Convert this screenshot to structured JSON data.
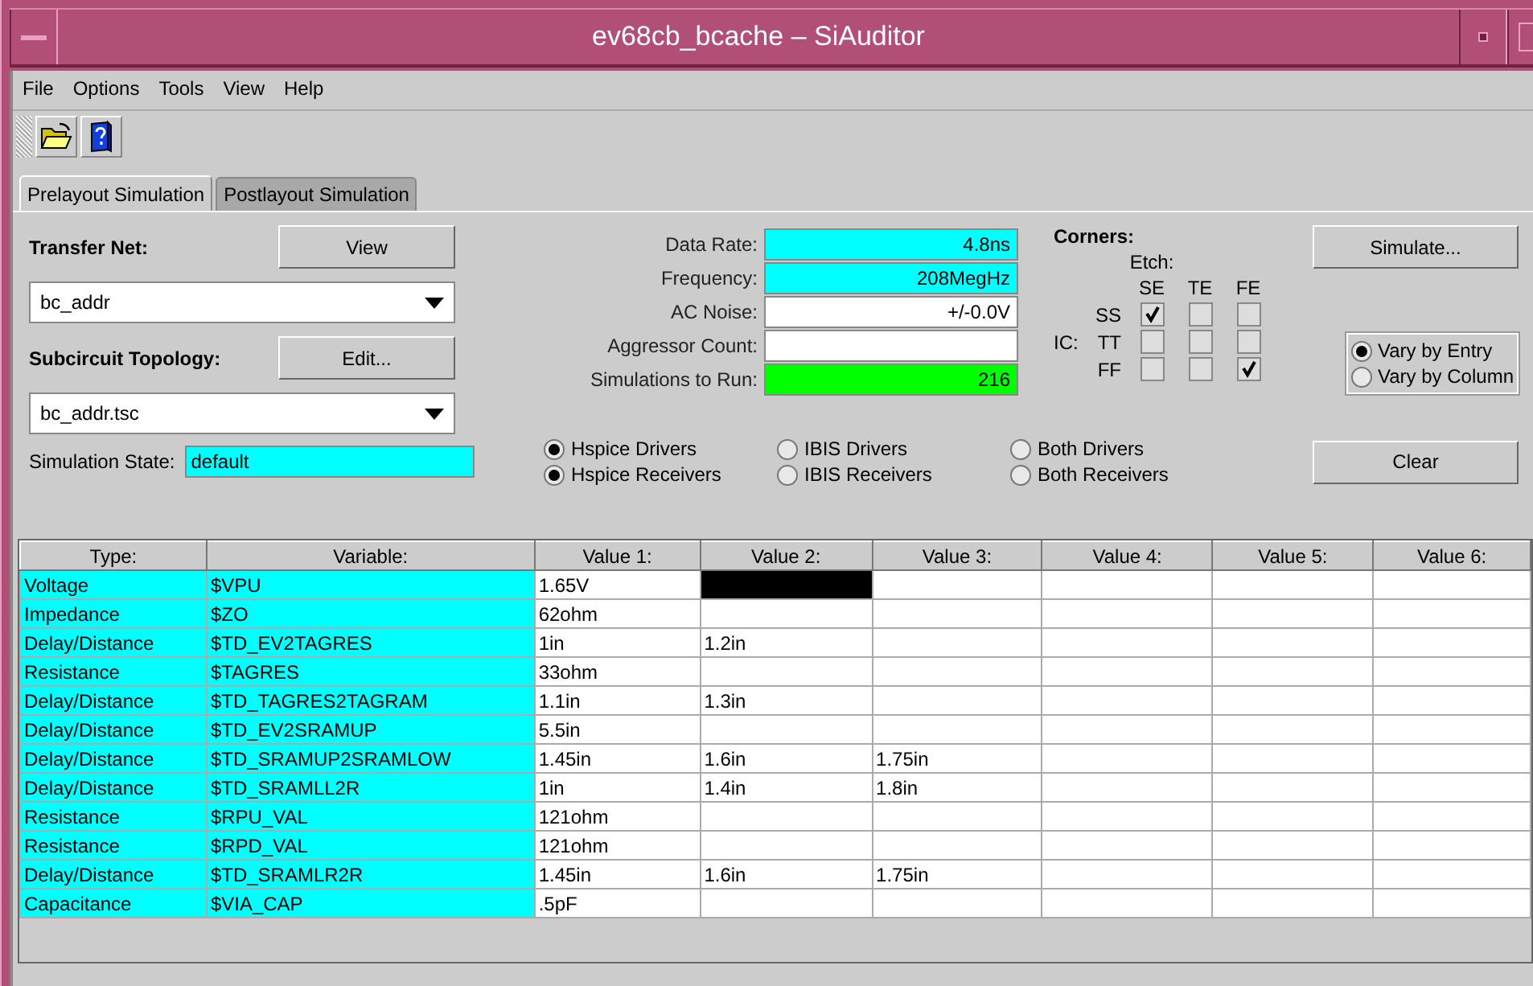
{
  "window": {
    "title": "ev68cb_bcache – SiAuditor"
  },
  "menu": [
    "File",
    "Options",
    "Tools",
    "View",
    "Help"
  ],
  "tabs": [
    {
      "label": "Prelayout Simulation",
      "selected": true
    },
    {
      "label": "Postlayout Simulation",
      "selected": false
    }
  ],
  "transfer_net": {
    "label": "Transfer Net:",
    "button": "View",
    "value": "bc_addr"
  },
  "subcircuit": {
    "label": "Subcircuit Topology:",
    "button": "Edit...",
    "value": "bc_addr.tsc"
  },
  "simulation_state": {
    "label": "Simulation State:",
    "value": "default"
  },
  "fields": [
    {
      "label": "Data Rate:",
      "value": "4.8ns",
      "color": "#00ffff"
    },
    {
      "label": "Frequency:",
      "value": "208MegHz",
      "color": "#00ffff"
    },
    {
      "label": "AC Noise:",
      "value": "+/-0.0V",
      "color": "#ffffff"
    },
    {
      "label": "Aggressor Count:",
      "color": "#ffffff"
    },
    {
      "label": "Simulations to Run:",
      "value": "216",
      "color": "#00ff00"
    }
  ],
  "corners": {
    "title": "Corners:",
    "etch_label": "Etch:",
    "ic_label": "IC:",
    "columns": [
      "SE",
      "TE",
      "FE"
    ],
    "rows": [
      {
        "label": "SS",
        "checks": [
          true,
          false,
          false
        ]
      },
      {
        "label": "TT",
        "checks": [
          false,
          false,
          false
        ]
      },
      {
        "label": "FF",
        "checks": [
          false,
          false,
          true
        ]
      }
    ]
  },
  "simulate_button": "Simulate...",
  "vary": [
    {
      "label": "Vary by Entry",
      "selected": true
    },
    {
      "label": "Vary by Column",
      "selected": false
    }
  ],
  "model_options": [
    [
      {
        "label": "Hspice Drivers",
        "selected": true
      },
      {
        "label": "IBIS Drivers",
        "selected": false
      },
      {
        "label": "Both Drivers",
        "selected": false
      }
    ],
    [
      {
        "label": "Hspice Receivers",
        "selected": true
      },
      {
        "label": "IBIS Receivers",
        "selected": false
      },
      {
        "label": "Both Receivers",
        "selected": false
      }
    ]
  ],
  "clear_button": "Clear",
  "table": {
    "columns": [
      "Type:",
      "Variable:",
      "Value 1:",
      "Value 2:",
      "Value 3:",
      "Value 4:",
      "Value 5:",
      "Value 6:"
    ],
    "rows": [
      {
        "cells": [
          {
            "text": "Voltage",
            "selected": false
          },
          {
            "text": "$VPU",
            "selected": false
          },
          {
            "text": "1.65V",
            "selected": false
          },
          {
            "text": "",
            "selected": true
          },
          {
            "text": "",
            "selected": false
          },
          {
            "text": "",
            "selected": false
          },
          {
            "text": "",
            "selected": false
          },
          {
            "text": "",
            "selected": false
          }
        ]
      },
      {
        "cells": [
          {
            "text": "Impedance",
            "selected": false
          },
          {
            "text": "$ZO",
            "selected": false
          },
          {
            "text": "62ohm",
            "selected": false
          },
          {
            "text": "",
            "selected": false
          },
          {
            "text": "",
            "selected": false
          },
          {
            "text": "",
            "selected": false
          },
          {
            "text": "",
            "selected": false
          },
          {
            "text": "",
            "selected": false
          }
        ]
      },
      {
        "cells": [
          {
            "text": "Delay/Distance",
            "selected": false
          },
          {
            "text": "$TD_EV2TAGRES",
            "selected": false
          },
          {
            "text": "1in",
            "selected": false
          },
          {
            "text": "1.2in",
            "selected": false
          },
          {
            "text": "",
            "selected": false
          },
          {
            "text": "",
            "selected": false
          },
          {
            "text": "",
            "selected": false
          },
          {
            "text": "",
            "selected": false
          }
        ]
      },
      {
        "cells": [
          {
            "text": "Resistance",
            "selected": false
          },
          {
            "text": "$TAGRES",
            "selected": false
          },
          {
            "text": "33ohm",
            "selected": false
          },
          {
            "text": "",
            "selected": false
          },
          {
            "text": "",
            "selected": false
          },
          {
            "text": "",
            "selected": false
          },
          {
            "text": "",
            "selected": false
          },
          {
            "text": "",
            "selected": false
          }
        ]
      },
      {
        "cells": [
          {
            "text": "Delay/Distance",
            "selected": false
          },
          {
            "text": "$TD_TAGRES2TAGRAM",
            "selected": false
          },
          {
            "text": "1.1in",
            "selected": false
          },
          {
            "text": "1.3in",
            "selected": false
          },
          {
            "text": "",
            "selected": false
          },
          {
            "text": "",
            "selected": false
          },
          {
            "text": "",
            "selected": false
          },
          {
            "text": "",
            "selected": false
          }
        ]
      },
      {
        "cells": [
          {
            "text": "Delay/Distance",
            "selected": false
          },
          {
            "text": "$TD_EV2SRAMUP",
            "selected": false
          },
          {
            "text": "5.5in",
            "selected": false
          },
          {
            "text": "",
            "selected": false
          },
          {
            "text": "",
            "selected": false
          },
          {
            "text": "",
            "selected": false
          },
          {
            "text": "",
            "selected": false
          },
          {
            "text": "",
            "selected": false
          }
        ]
      },
      {
        "cells": [
          {
            "text": "Delay/Distance",
            "selected": false
          },
          {
            "text": "$TD_SRAMUP2SRAMLOW",
            "selected": false
          },
          {
            "text": "1.45in",
            "selected": false
          },
          {
            "text": "1.6in",
            "selected": false
          },
          {
            "text": "1.75in",
            "selected": false
          },
          {
            "text": "",
            "selected": false
          },
          {
            "text": "",
            "selected": false
          },
          {
            "text": "",
            "selected": false
          }
        ]
      },
      {
        "cells": [
          {
            "text": "Delay/Distance",
            "selected": false
          },
          {
            "text": "$TD_SRAMLL2R",
            "selected": false
          },
          {
            "text": "1in",
            "selected": false
          },
          {
            "text": "1.4in",
            "selected": false
          },
          {
            "text": "1.8in",
            "selected": false
          },
          {
            "text": "",
            "selected": false
          },
          {
            "text": "",
            "selected": false
          },
          {
            "text": "",
            "selected": false
          }
        ]
      },
      {
        "cells": [
          {
            "text": "Resistance",
            "selected": false
          },
          {
            "text": "$RPU_VAL",
            "selected": false
          },
          {
            "text": "121ohm",
            "selected": false
          },
          {
            "text": "",
            "selected": false
          },
          {
            "text": "",
            "selected": false
          },
          {
            "text": "",
            "selected": false
          },
          {
            "text": "",
            "selected": false
          },
          {
            "text": "",
            "selected": false
          }
        ]
      },
      {
        "cells": [
          {
            "text": "Resistance",
            "selected": false
          },
          {
            "text": "$RPD_VAL",
            "selected": false
          },
          {
            "text": "121ohm",
            "selected": false
          },
          {
            "text": "",
            "selected": false
          },
          {
            "text": "",
            "selected": false
          },
          {
            "text": "",
            "selected": false
          },
          {
            "text": "",
            "selected": false
          },
          {
            "text": "",
            "selected": false
          }
        ]
      },
      {
        "cells": [
          {
            "text": "Delay/Distance",
            "selected": false
          },
          {
            "text": "$TD_SRAMLR2R",
            "selected": false
          },
          {
            "text": "1.45in",
            "selected": false
          },
          {
            "text": "1.6in",
            "selected": false
          },
          {
            "text": "1.75in",
            "selected": false
          },
          {
            "text": "",
            "selected": false
          },
          {
            "text": "",
            "selected": false
          },
          {
            "text": "",
            "selected": false
          }
        ]
      },
      {
        "cells": [
          {
            "text": "Capacitance",
            "selected": false
          },
          {
            "text": "$VIA_CAP",
            "selected": false
          },
          {
            "text": ".5pF",
            "selected": false
          },
          {
            "text": "",
            "selected": false
          },
          {
            "text": "",
            "selected": false
          },
          {
            "text": "",
            "selected": false
          },
          {
            "text": "",
            "selected": false
          },
          {
            "text": "",
            "selected": false
          }
        ]
      }
    ]
  }
}
